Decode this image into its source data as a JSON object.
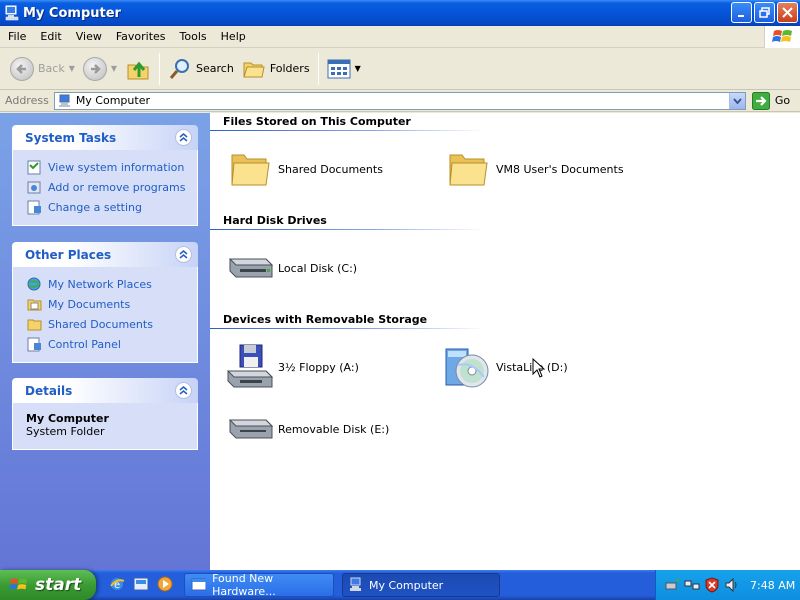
{
  "window": {
    "title": "My Computer",
    "controls": [
      "minimize-icon",
      "maximize-icon",
      "close-icon"
    ]
  },
  "menubar": {
    "items": [
      "File",
      "Edit",
      "View",
      "Favorites",
      "Tools",
      "Help"
    ]
  },
  "toolbar": {
    "back_label": "Back",
    "search_label": "Search",
    "folders_label": "Folders"
  },
  "address": {
    "label": "Address",
    "value": "My Computer",
    "go_label": "Go"
  },
  "sidebar": {
    "system_tasks": {
      "title": "System Tasks",
      "items": [
        {
          "label": "View system information",
          "icon": "system-info-icon"
        },
        {
          "label": "Add or remove programs",
          "icon": "add-remove-programs-icon"
        },
        {
          "label": "Change a setting",
          "icon": "control-panel-icon"
        }
      ]
    },
    "other_places": {
      "title": "Other Places",
      "items": [
        {
          "label": "My Network Places",
          "icon": "network-places-icon"
        },
        {
          "label": "My Documents",
          "icon": "my-documents-icon"
        },
        {
          "label": "Shared Documents",
          "icon": "folder-icon"
        },
        {
          "label": "Control Panel",
          "icon": "control-panel-icon"
        }
      ]
    },
    "details": {
      "title": "Details",
      "name": "My Computer",
      "type": "System Folder"
    }
  },
  "main": {
    "groups": [
      {
        "title": "Files Stored on This Computer",
        "items": [
          {
            "label": "Shared Documents",
            "icon": "folder-icon"
          },
          {
            "label": "VM8 User's Documents",
            "icon": "folder-icon"
          }
        ]
      },
      {
        "title": "Hard Disk Drives",
        "items": [
          {
            "label": "Local Disk (C:)",
            "icon": "hard-disk-icon"
          }
        ]
      },
      {
        "title": "Devices with Removable Storage",
        "items": [
          {
            "label": "3½ Floppy (A:)",
            "icon": "floppy-drive-icon"
          },
          {
            "label": "VistaLite (D:)",
            "icon": "cd-drive-icon"
          },
          {
            "label": "Removable Disk (E:)",
            "icon": "removable-disk-icon"
          }
        ]
      }
    ]
  },
  "taskbar": {
    "start_label": "start",
    "buttons": [
      {
        "label": "Found New Hardware...",
        "icon": "hardware-wizard-icon"
      },
      {
        "label": "My Computer",
        "icon": "my-computer-icon"
      }
    ],
    "clock": "7:48 AM"
  },
  "colors": {
    "title_bar": "#0654d8",
    "sidebar_bg": "#7ba2e7",
    "link_blue": "#215dc6",
    "taskbar": "#245edb",
    "start_green": "#3c9b33"
  }
}
